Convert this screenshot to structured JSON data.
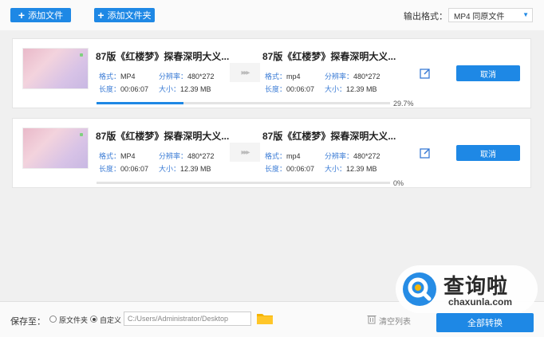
{
  "toolbar": {
    "add_file": "添加文件",
    "add_folder": "添加文件夹",
    "output_format_label": "输出格式：",
    "output_format_value": "MP4  同原文件"
  },
  "tasks": [
    {
      "src_name": "87版《红楼梦》探春深明大义...",
      "src_format_k": "格式：",
      "src_format": "MP4",
      "src_res_k": "分辨率：",
      "src_res": "480*272",
      "src_len_k": "长度：",
      "src_len": "00:06:07",
      "src_size_k": "大小：",
      "src_size": "12.39 MB",
      "dst_name": "87版《红楼梦》探春深明大义...",
      "dst_format_k": "格式：",
      "dst_format": "mp4",
      "dst_res_k": "分辨率：",
      "dst_res": "480*272",
      "dst_len_k": "长度：",
      "dst_len": "00:06:07",
      "dst_size_k": "大小：",
      "dst_size": "12.39 MB",
      "cancel": "取消",
      "progress_text": "29.7%",
      "progress": 0.297
    },
    {
      "src_name": "87版《红楼梦》探春深明大义...",
      "src_format_k": "格式：",
      "src_format": "MP4",
      "src_res_k": "分辨率：",
      "src_res": "480*272",
      "src_len_k": "长度：",
      "src_len": "00:06:07",
      "src_size_k": "大小：",
      "src_size": "12.39 MB",
      "dst_name": "87版《红楼梦》探春深明大义...",
      "dst_format_k": "格式：",
      "dst_format": "mp4",
      "dst_res_k": "分辨率：",
      "dst_res": "480*272",
      "dst_len_k": "长度：",
      "dst_len": "00:06:07",
      "dst_size_k": "大小：",
      "dst_size": "12.39 MB",
      "cancel": "取消",
      "progress_text": "0%",
      "progress": 0
    }
  ],
  "bottom": {
    "save_to": "保存至：",
    "opt_original": "原文件夹",
    "opt_custom": "自定义",
    "path": "C:/Users/Administrator/Desktop",
    "clear_list": "清空列表",
    "convert": "全部转换"
  },
  "watermark": {
    "cn": "查询啦",
    "en": "chaxunla.com"
  },
  "colors": {
    "accent": "#1e88e5",
    "background": "#f0f0f0"
  }
}
